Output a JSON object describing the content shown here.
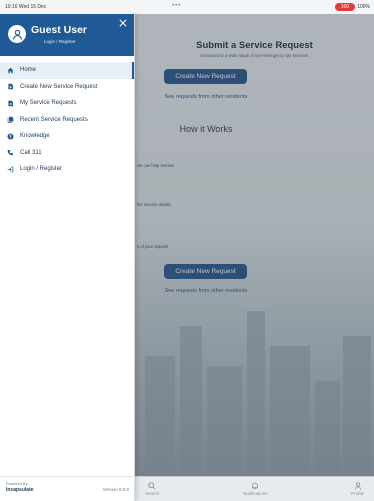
{
  "status_bar": {
    "time": "10:16  Wed 15 Dec",
    "dots": "•••",
    "battery_pill": "100",
    "battery_text": "100%"
  },
  "main": {
    "title": "Submit a Service Request",
    "subtitle": "connected to a wide range of non-emergency city services.",
    "create_button": "Create New Request",
    "see_link": "See requests from other residents",
    "how_it_works": "How it Works",
    "step1": "we can help resolve.",
    "step2": "the service details.",
    "step3": "s of your request."
  },
  "drawer": {
    "user_name": "Guest User",
    "user_sub": "Login / Register",
    "items": [
      {
        "label": "Home",
        "icon": "home-icon"
      },
      {
        "label": "Create New Service Request",
        "icon": "new-doc-icon"
      },
      {
        "label": "My Service Requests",
        "icon": "doc-icon"
      },
      {
        "label": "Recent Service Requests",
        "icon": "docs-icon"
      },
      {
        "label": "Knowledge",
        "icon": "help-icon"
      },
      {
        "label": "Call 311",
        "icon": "phone-icon"
      },
      {
        "label": "Login / Register",
        "icon": "login-icon"
      }
    ],
    "footer": {
      "powered_label": "Powered By",
      "powered_name": "Incapsulate",
      "version": "Version 8.0.0"
    }
  },
  "tabbar": {
    "search": "Search",
    "notifications": "Notifications",
    "profile": "Profile"
  },
  "colors": {
    "brand": "#205a96",
    "button": "#1f4f86"
  }
}
